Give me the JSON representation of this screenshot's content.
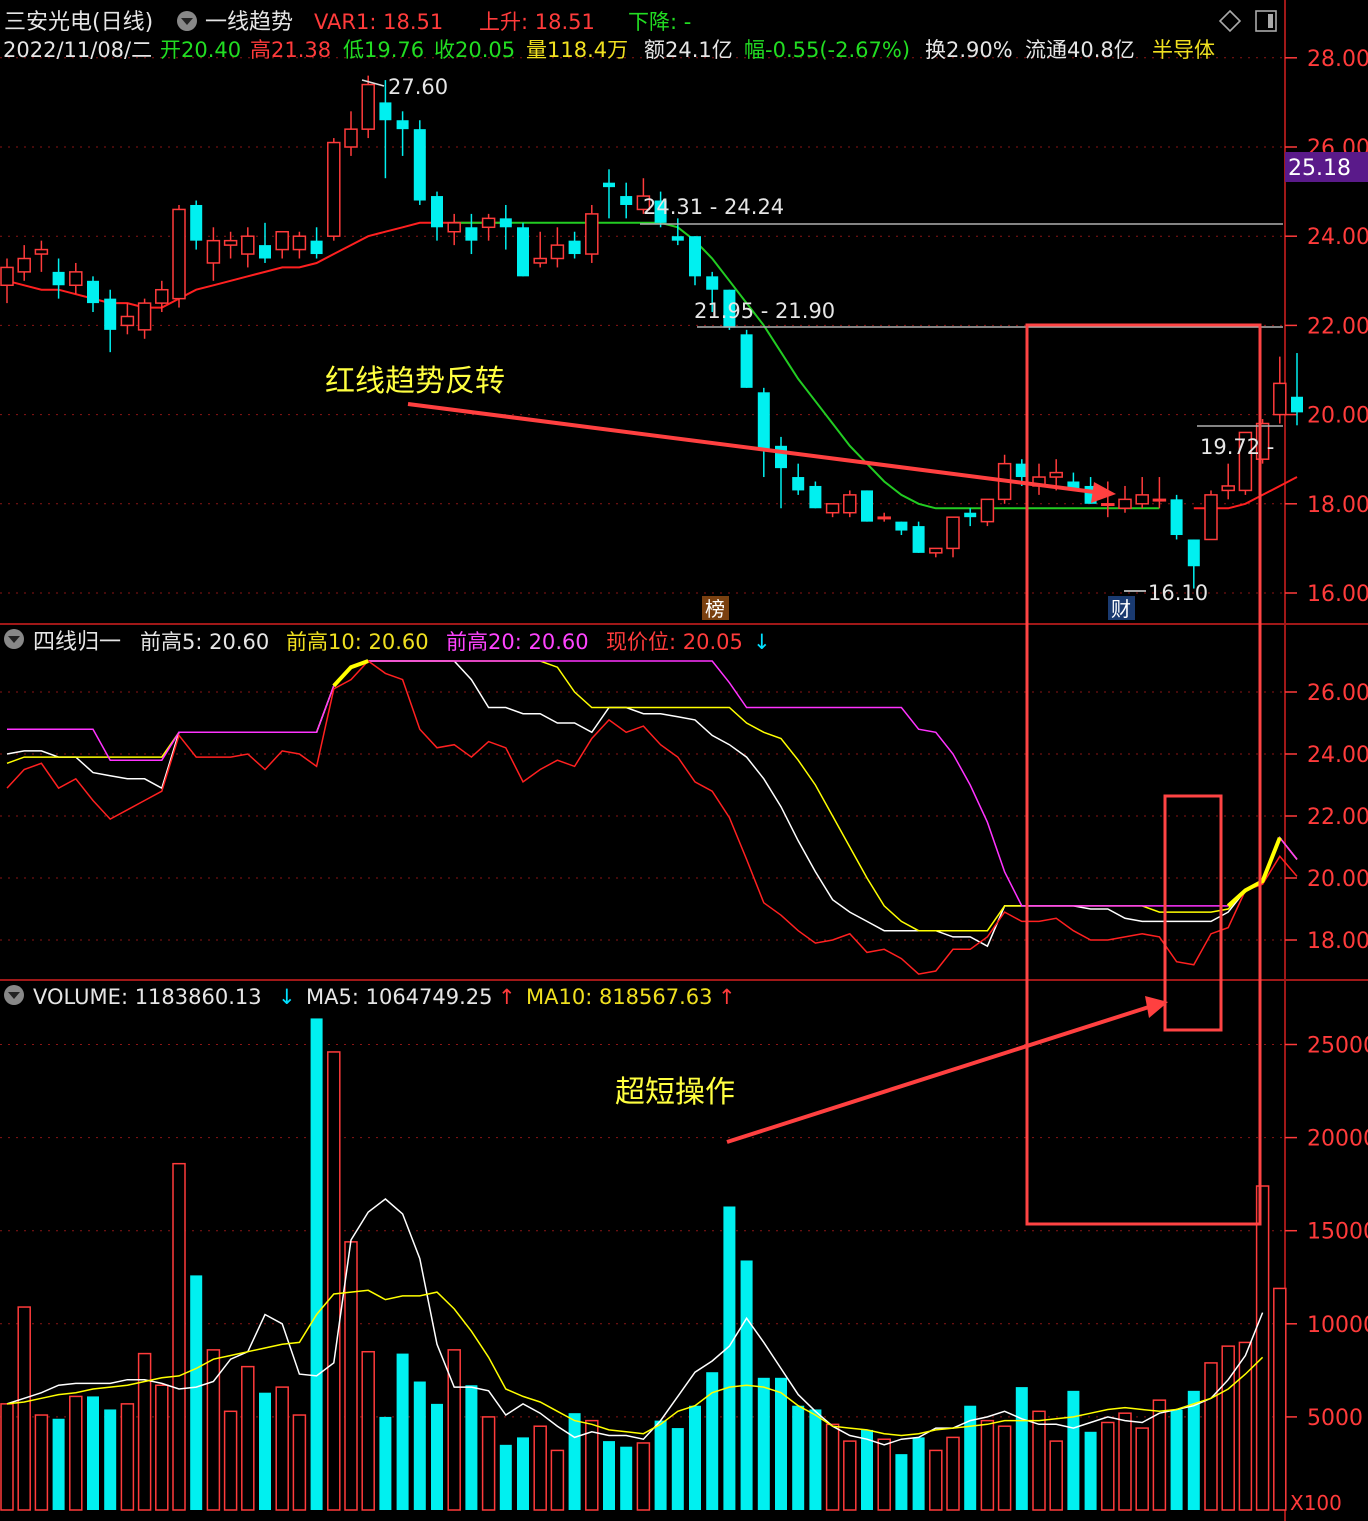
{
  "header": {
    "stock_name": "三安光电(日线)",
    "indicator_name": "一线趋势",
    "var1": "VAR1: 18.51",
    "rise": "上升: 18.51",
    "fall": "下降: -",
    "date": "2022/11/08/二",
    "open": "开20.40",
    "high": "高21.38",
    "low": "低19.76",
    "close": "收20.05",
    "volume": "量118.4万",
    "amount": "额24.1亿",
    "change": "幅-0.55(-2.67%)",
    "turnover": "换2.90%",
    "float": "流通40.8亿",
    "sector": "半导体",
    "price_tag": "25.18"
  },
  "panel2": {
    "name": "四线归一",
    "h5": "前高5: 20.60",
    "h10": "前高10: 20.60",
    "h20": "前高20: 20.60",
    "pos": "现价位: 20.05"
  },
  "panel3": {
    "name": "VOLUME: 1183860.13",
    "ma5": "MA5: 1064749.25",
    "ma10": "MA10: 818567.63",
    "unit": "X100"
  },
  "annotations": {
    "trend_reversal": "红线趋势反转",
    "ultra_short": "超短操作",
    "lbl_high": "27.60",
    "lbl_r1": "24.31 - 24.24",
    "lbl_r2": "21.95 - 21.90",
    "lbl_low": "16.10",
    "lbl_last": "19.72 -",
    "badge_rank": "榜",
    "badge_fin": "财"
  },
  "colors": {
    "up": "#ff3b3b",
    "down": "#00f0f0",
    "ma_red": "#ff2020",
    "ma_green": "#22cc22",
    "white": "#ffffff",
    "yellow": "#ffff00",
    "magenta": "#ff33ff",
    "grid": "#8a1515"
  },
  "chart_data": [
    {
      "type": "candlestick",
      "title": "三安光电(日线) 一线趋势",
      "ylim": [
        15.2,
        28.8
      ],
      "yticks": [
        16,
        18,
        20,
        22,
        24,
        26,
        28
      ],
      "ytick_labels": [
        "16.00",
        "18.00",
        "20.00",
        "22.00",
        "24.00",
        "26.00",
        "28.00"
      ],
      "ohlc": [
        [
          22.9,
          23.5,
          22.5,
          23.3
        ],
        [
          23.2,
          23.8,
          23.0,
          23.5
        ],
        [
          23.6,
          23.9,
          23.2,
          23.7
        ],
        [
          23.2,
          23.5,
          22.6,
          22.9
        ],
        [
          22.9,
          23.4,
          22.7,
          23.2
        ],
        [
          23.0,
          23.1,
          22.3,
          22.5
        ],
        [
          22.6,
          22.8,
          21.4,
          21.9
        ],
        [
          22.0,
          22.5,
          21.8,
          22.2
        ],
        [
          21.9,
          22.6,
          21.7,
          22.5
        ],
        [
          22.5,
          23.0,
          22.3,
          22.8
        ],
        [
          22.6,
          24.7,
          22.4,
          24.6
        ],
        [
          24.7,
          24.8,
          23.7,
          23.9
        ],
        [
          23.4,
          24.2,
          23.0,
          23.9
        ],
        [
          23.8,
          24.1,
          23.5,
          23.9
        ],
        [
          23.6,
          24.2,
          23.3,
          24.0
        ],
        [
          23.8,
          24.3,
          23.4,
          23.5
        ],
        [
          23.7,
          24.1,
          23.5,
          24.1
        ],
        [
          23.7,
          24.1,
          23.5,
          24.0
        ],
        [
          23.9,
          24.2,
          23.5,
          23.6
        ],
        [
          24.0,
          26.2,
          23.9,
          26.1
        ],
        [
          26.0,
          26.8,
          25.8,
          26.4
        ],
        [
          26.4,
          27.6,
          26.2,
          27.4
        ],
        [
          27.0,
          27.5,
          25.3,
          26.6
        ],
        [
          26.6,
          26.8,
          25.8,
          26.4
        ],
        [
          26.4,
          26.6,
          24.7,
          24.8
        ],
        [
          24.9,
          25.0,
          23.9,
          24.2
        ],
        [
          24.1,
          24.5,
          23.8,
          24.3
        ],
        [
          24.2,
          24.5,
          23.6,
          23.9
        ],
        [
          24.2,
          24.5,
          23.9,
          24.4
        ],
        [
          24.4,
          24.7,
          23.7,
          24.2
        ],
        [
          24.2,
          24.3,
          23.1,
          23.1
        ],
        [
          23.4,
          24.1,
          23.3,
          23.5
        ],
        [
          23.5,
          24.2,
          23.3,
          23.8
        ],
        [
          23.9,
          24.1,
          23.5,
          23.6
        ],
        [
          23.6,
          24.7,
          23.4,
          24.5
        ],
        [
          25.2,
          25.5,
          24.4,
          25.1
        ],
        [
          24.9,
          25.2,
          24.4,
          24.7
        ],
        [
          24.6,
          25.3,
          24.5,
          24.9
        ],
        [
          24.8,
          25.0,
          24.2,
          24.3
        ],
        [
          24.0,
          24.4,
          23.8,
          23.9
        ],
        [
          24.0,
          24.0,
          22.9,
          23.1
        ],
        [
          23.1,
          23.2,
          22.3,
          22.8
        ],
        [
          22.8,
          22.8,
          21.9,
          21.95
        ],
        [
          21.8,
          21.9,
          20.6,
          20.6
        ],
        [
          20.5,
          20.6,
          18.6,
          19.2
        ],
        [
          19.3,
          19.5,
          17.9,
          18.8
        ],
        [
          18.6,
          18.9,
          18.2,
          18.3
        ],
        [
          18.4,
          18.5,
          17.9,
          17.9
        ],
        [
          17.8,
          18.0,
          17.7,
          18.0
        ],
        [
          17.8,
          18.3,
          17.7,
          18.2
        ],
        [
          18.3,
          18.3,
          17.6,
          17.6
        ],
        [
          17.7,
          17.8,
          17.6,
          17.7
        ],
        [
          17.6,
          17.6,
          17.3,
          17.4
        ],
        [
          17.5,
          17.6,
          16.9,
          16.9
        ],
        [
          16.9,
          17.0,
          16.8,
          17.0
        ],
        [
          17.0,
          17.7,
          16.8,
          17.7
        ],
        [
          17.8,
          17.9,
          17.5,
          17.7
        ],
        [
          17.6,
          18.1,
          17.5,
          18.1
        ],
        [
          18.1,
          19.1,
          18.0,
          18.9
        ],
        [
          18.9,
          19.0,
          18.4,
          18.6
        ],
        [
          18.4,
          18.9,
          18.2,
          18.6
        ],
        [
          18.6,
          19.0,
          18.3,
          18.7
        ],
        [
          18.5,
          18.7,
          18.3,
          18.3
        ],
        [
          18.4,
          18.6,
          18.0,
          18.0
        ],
        [
          18.0,
          18.5,
          17.7,
          18.0
        ],
        [
          17.9,
          18.4,
          17.8,
          18.1
        ],
        [
          18.0,
          18.6,
          17.9,
          18.2
        ],
        [
          18.1,
          18.6,
          17.9,
          18.1
        ],
        [
          18.1,
          18.2,
          17.2,
          17.3
        ],
        [
          17.2,
          17.2,
          16.1,
          16.6
        ],
        [
          17.2,
          18.3,
          17.2,
          18.2
        ],
        [
          18.3,
          18.9,
          18.1,
          18.4
        ],
        [
          18.3,
          19.6,
          18.2,
          19.6
        ],
        [
          19.0,
          19.9,
          18.9,
          19.8
        ],
        [
          20.0,
          21.3,
          19.8,
          20.7
        ],
        [
          20.4,
          21.38,
          19.76,
          20.05
        ]
      ],
      "trend_line_red": [
        23.0,
        22.9,
        22.8,
        22.8,
        22.7,
        22.6,
        22.5,
        22.5,
        22.4,
        22.4,
        22.6,
        22.8,
        22.9,
        23.0,
        23.1,
        23.2,
        23.3,
        23.3,
        23.4,
        23.6,
        23.8,
        24.0,
        24.1,
        24.2,
        24.3,
        24.3,
        24.3,
        24.3,
        24.3,
        24.3
      ],
      "trend_line_green_from": 26,
      "trend_line_green": [
        24.3,
        24.3,
        24.3,
        24.3,
        24.3,
        24.3,
        24.3,
        24.3,
        24.3,
        24.3,
        24.3,
        24.3,
        24.3,
        24.2,
        23.9,
        23.5,
        23.0,
        22.5,
        22.0,
        21.4,
        20.8,
        20.3,
        19.8,
        19.3,
        18.9,
        18.5,
        18.2,
        18.0,
        17.9,
        17.9,
        17.9,
        17.9,
        17.9,
        17.9,
        17.9,
        17.9,
        17.9,
        17.9,
        17.9,
        17.9,
        17.9,
        17.9
      ],
      "trend_line_red2": [
        17.9,
        17.9,
        17.9,
        18.0,
        18.2,
        18.4,
        18.6
      ],
      "resistance": [
        24.31,
        21.95,
        19.72
      ],
      "high": 27.6,
      "low": 16.1
    },
    {
      "type": "line",
      "title": "四线归一",
      "ylim": [
        17.0,
        27.6
      ],
      "yticks": [
        18,
        20,
        22,
        24,
        26
      ],
      "ytick_labels": [
        "18.00",
        "20.00",
        "22.00",
        "24.00",
        "26.00"
      ],
      "series": [
        {
          "name": "前高5",
          "color": "#ffffff",
          "values": [
            24.0,
            24.1,
            24.1,
            23.9,
            23.9,
            23.4,
            23.3,
            23.2,
            23.2,
            22.9,
            24.7,
            24.7,
            24.7,
            24.7,
            24.7,
            24.7,
            24.7,
            24.7,
            24.7,
            26.2,
            26.8,
            27.0,
            27.0,
            27.0,
            27.0,
            27.0,
            27.0,
            26.4,
            25.5,
            25.5,
            25.3,
            25.3,
            25.0,
            25.0,
            24.7,
            25.5,
            25.5,
            25.3,
            25.3,
            25.2,
            25.1,
            24.6,
            24.3,
            23.9,
            23.2,
            22.3,
            21.2,
            20.2,
            19.3,
            18.9,
            18.6,
            18.3,
            18.3,
            18.3,
            18.3,
            18.1,
            18.1,
            17.8,
            19.1,
            19.1,
            19.1,
            19.1,
            19.1,
            19.0,
            19.0,
            18.7,
            18.6,
            18.6,
            18.6,
            18.6,
            18.6,
            18.9,
            19.6,
            19.9,
            21.3,
            20.6
          ]
        },
        {
          "name": "前高10",
          "color": "#ffff00",
          "values": [
            23.7,
            23.9,
            23.9,
            23.9,
            23.9,
            23.9,
            23.9,
            23.9,
            23.9,
            23.9,
            24.7,
            24.7,
            24.7,
            24.7,
            24.7,
            24.7,
            24.7,
            24.7,
            24.7,
            26.2,
            26.8,
            27.0,
            27.0,
            27.0,
            27.0,
            27.0,
            27.0,
            27.0,
            27.0,
            27.0,
            27.0,
            27.0,
            26.8,
            26.0,
            25.5,
            25.5,
            25.5,
            25.5,
            25.5,
            25.5,
            25.5,
            25.5,
            25.5,
            25.0,
            24.7,
            24.5,
            23.8,
            23.0,
            22.0,
            21.0,
            20.0,
            19.1,
            18.6,
            18.3,
            18.3,
            18.3,
            18.3,
            18.3,
            19.1,
            19.1,
            19.1,
            19.1,
            19.1,
            19.1,
            19.1,
            19.1,
            19.1,
            18.9,
            18.9,
            18.9,
            18.9,
            19.0,
            19.6,
            19.9,
            21.3,
            20.6
          ]
        },
        {
          "name": "前高20",
          "color": "#ff33ff",
          "values": [
            24.8,
            24.8,
            24.8,
            24.8,
            24.8,
            24.8,
            23.8,
            23.8,
            23.8,
            23.8,
            24.7,
            24.7,
            24.7,
            24.7,
            24.7,
            24.7,
            24.7,
            24.7,
            24.7,
            26.2,
            26.8,
            27.0,
            27.0,
            27.0,
            27.0,
            27.0,
            27.0,
            27.0,
            27.0,
            27.0,
            27.0,
            27.0,
            27.0,
            27.0,
            27.0,
            27.0,
            27.0,
            27.0,
            27.0,
            27.0,
            27.0,
            27.0,
            26.3,
            25.5,
            25.5,
            25.5,
            25.5,
            25.5,
            25.5,
            25.5,
            25.5,
            25.5,
            25.5,
            24.8,
            24.7,
            24.0,
            23.0,
            21.8,
            20.2,
            19.1,
            19.1,
            19.1,
            19.1,
            19.1,
            19.1,
            19.1,
            19.1,
            19.1,
            19.1,
            19.1,
            19.1,
            19.1,
            19.6,
            19.9,
            21.3,
            20.6
          ]
        },
        {
          "name": "现价位",
          "color": "#ff2020",
          "values": [
            22.9,
            23.5,
            23.7,
            22.9,
            23.2,
            22.5,
            21.9,
            22.2,
            22.5,
            22.8,
            24.6,
            23.9,
            23.9,
            23.9,
            24.0,
            23.5,
            24.1,
            24.0,
            23.6,
            26.1,
            26.4,
            27.0,
            26.6,
            26.4,
            24.8,
            24.2,
            24.3,
            23.9,
            24.4,
            24.2,
            23.1,
            23.5,
            23.8,
            23.6,
            24.5,
            25.1,
            24.7,
            24.9,
            24.3,
            23.9,
            23.1,
            22.8,
            21.95,
            20.6,
            19.2,
            18.8,
            18.3,
            17.9,
            18.0,
            18.2,
            17.6,
            17.7,
            17.4,
            16.9,
            17.0,
            17.7,
            17.7,
            18.1,
            18.9,
            18.6,
            18.6,
            18.7,
            18.3,
            18.0,
            18.0,
            18.1,
            18.2,
            18.1,
            17.3,
            17.2,
            18.2,
            18.4,
            19.6,
            19.8,
            20.7,
            20.05
          ]
        }
      ]
    },
    {
      "type": "bar",
      "title": "VOLUME",
      "ylim": [
        0,
        29000
      ],
      "yticks": [
        5000,
        10000,
        15000,
        20000,
        25000
      ],
      "ytick_labels": [
        "5000",
        "10000",
        "15000",
        "20000",
        "25000"
      ],
      "values": [
        5700,
        10900,
        5100,
        4900,
        6100,
        6100,
        5400,
        5700,
        8400,
        6700,
        18600,
        12600,
        8600,
        5300,
        7700,
        6300,
        6600,
        5100,
        26400,
        24600,
        14400,
        8500,
        5000,
        8400,
        6900,
        5700,
        8600,
        6700,
        5000,
        3500,
        3900,
        4500,
        3200,
        5200,
        4800,
        3700,
        3400,
        3600,
        4800,
        4400,
        5600,
        7400,
        16300,
        13400,
        7100,
        7100,
        5600,
        5400,
        4600,
        3700,
        4300,
        3800,
        3000,
        3900,
        3200,
        3900,
        5600,
        4800,
        4500,
        6600,
        5300,
        3700,
        6400,
        4200,
        4700,
        5200,
        4400,
        5900,
        5400,
        6400,
        7900,
        8800,
        9000,
        17400,
        11900
      ],
      "ma5": [
        5700,
        6000,
        6300,
        6700,
        6800,
        6800,
        6800,
        7000,
        7000,
        6800,
        6500,
        6600,
        6900,
        8100,
        8500,
        10500,
        10000,
        7300,
        7200,
        7900,
        14500,
        16000,
        16700,
        15900,
        13500,
        8900,
        6600,
        6600,
        6400,
        5100,
        5700,
        5200,
        4500,
        3900,
        4200,
        4000,
        4000,
        3800,
        4800,
        6100,
        7400,
        8000,
        8800,
        10300,
        9000,
        7600,
        6200,
        5300,
        4500,
        4000,
        3800,
        3500,
        3800,
        3900,
        4400,
        4400,
        4800,
        5000,
        5300,
        4900,
        4600,
        4600,
        4400,
        4700,
        5000,
        4800,
        4700,
        5200,
        5400,
        5600,
        6000,
        7000,
        8300,
        10600
      ],
      "ma10": [
        5700,
        5800,
        6000,
        6200,
        6300,
        6500,
        6600,
        6700,
        6900,
        7100,
        7200,
        7600,
        8100,
        8300,
        8500,
        8700,
        8900,
        9000,
        10500,
        11600,
        11700,
        11800,
        11300,
        11500,
        11500,
        11700,
        10800,
        9600,
        8200,
        6500,
        6100,
        5800,
        5300,
        4800,
        4600,
        4300,
        4200,
        4100,
        4600,
        5300,
        5600,
        6300,
        6600,
        6700,
        6600,
        6300,
        5600,
        5100,
        4500,
        4400,
        4300,
        4100,
        4000,
        4100,
        4300,
        4400,
        4500,
        4600,
        4800,
        4800,
        4800,
        4900,
        5000,
        5200,
        5400,
        5500,
        5400,
        5300,
        5400,
        5700,
        6000,
        6500,
        7300,
        8200
      ]
    }
  ]
}
